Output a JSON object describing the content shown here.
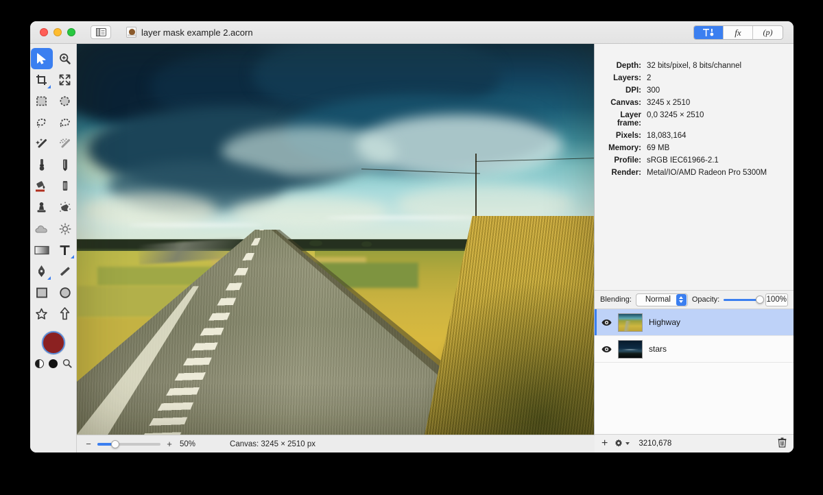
{
  "window": {
    "document_name": "layer mask example 2.acorn",
    "traffic_lights": [
      "close",
      "minimize",
      "zoom"
    ],
    "sidebar_toggle": "sidebar-toggle",
    "view_segments": [
      {
        "name": "inspector",
        "label": "",
        "selected": true
      },
      {
        "name": "filters",
        "label": "fx",
        "selected": false
      },
      {
        "name": "presets",
        "label": "(p)",
        "selected": false
      }
    ]
  },
  "toolbox": {
    "tools": [
      {
        "name": "move-tool",
        "icon": "cursor-arrow-icon",
        "active": true
      },
      {
        "name": "zoom-tool",
        "icon": "magnifier-plus-icon",
        "active": false
      },
      {
        "name": "crop-tool",
        "icon": "crop-icon",
        "active": false,
        "submenu": true
      },
      {
        "name": "transform-tool",
        "icon": "arrows-expand-icon",
        "active": false
      },
      {
        "name": "rectangular-select-tool",
        "icon": "marquee-rect-icon",
        "active": false
      },
      {
        "name": "elliptical-select-tool",
        "icon": "marquee-ellipse-icon",
        "active": false
      },
      {
        "name": "lasso-tool",
        "icon": "lasso-icon",
        "active": false
      },
      {
        "name": "polygon-lasso-tool",
        "icon": "polygon-lasso-icon",
        "active": false
      },
      {
        "name": "magic-wand-tool",
        "icon": "magic-wand-icon",
        "active": false
      },
      {
        "name": "instant-alpha-tool",
        "icon": "instant-alpha-icon",
        "active": false
      },
      {
        "name": "brush-tool",
        "icon": "brush-icon",
        "active": false
      },
      {
        "name": "pencil-tool",
        "icon": "pencil-icon",
        "active": false
      },
      {
        "name": "paint-bucket-tool",
        "icon": "paint-bucket-icon",
        "active": false
      },
      {
        "name": "eraser-tool",
        "icon": "eraser-icon",
        "active": false
      },
      {
        "name": "clone-stamp-tool",
        "icon": "clone-stamp-icon",
        "active": false
      },
      {
        "name": "smudge-tool",
        "icon": "smudge-icon",
        "active": false
      },
      {
        "name": "blur-tool",
        "icon": "cloud-icon",
        "active": false
      },
      {
        "name": "dodge-tool",
        "icon": "sun-icon",
        "active": false
      },
      {
        "name": "gradient-tool",
        "icon": "gradient-icon",
        "active": false
      },
      {
        "name": "text-tool",
        "icon": "text-t-icon",
        "active": false,
        "submenu": true
      },
      {
        "name": "pen-tool",
        "icon": "fountain-pen-icon",
        "active": false,
        "submenu": true
      },
      {
        "name": "line-tool",
        "icon": "line-icon",
        "active": false
      },
      {
        "name": "rectangle-shape-tool",
        "icon": "square-icon",
        "active": false
      },
      {
        "name": "ellipse-shape-tool",
        "icon": "circle-icon",
        "active": false
      },
      {
        "name": "star-shape-tool",
        "icon": "star-icon",
        "active": false
      },
      {
        "name": "arrow-shape-tool",
        "icon": "arrow-up-icon",
        "active": false
      }
    ],
    "foreground_color": "#8b2121",
    "swatch_ring_color": "#5a8cd8",
    "color_extras": [
      {
        "name": "color-mode-toggle",
        "icon": "half-circle-icon"
      },
      {
        "name": "black-swatch",
        "icon": "filled-circle-icon"
      },
      {
        "name": "color-picker",
        "icon": "magnifier-icon"
      }
    ]
  },
  "info_panel": {
    "rows": [
      {
        "key": "Depth:",
        "value": "32 bits/pixel, 8 bits/channel"
      },
      {
        "key": "Layers:",
        "value": "2"
      },
      {
        "key": "DPI:",
        "value": "300"
      },
      {
        "key": "Canvas:",
        "value": "3245 x 2510"
      },
      {
        "key": "Layer frame:",
        "value": "0,0 3245 × 2510"
      },
      {
        "key": "Pixels:",
        "value": "18,083,164"
      },
      {
        "key": "Memory:",
        "value": "69 MB"
      },
      {
        "key": "Profile:",
        "value": "sRGB IEC61966-2.1"
      },
      {
        "key": "Render:",
        "value": "Metal/IO/AMD Radeon Pro 5300M"
      }
    ]
  },
  "blending_bar": {
    "blending_label": "Blending:",
    "blending_value": "Normal",
    "opacity_label": "Opacity:",
    "opacity_value": "100%",
    "opacity_percent": 100
  },
  "layers": [
    {
      "name": "Highway",
      "selected": true,
      "visible": true,
      "thumb": "highway-thumbnail"
    },
    {
      "name": "stars",
      "selected": false,
      "visible": true,
      "thumb": "stars-thumbnail"
    }
  ],
  "layer_tools": {
    "add_label": "+",
    "gear": "gear-icon",
    "coordinates": "3210,678",
    "delete": "trash-icon"
  },
  "status_bar": {
    "zoom_minus": "−",
    "zoom_plus": "+",
    "zoom_level": "50%",
    "zoom_percent": 50,
    "canvas_info": "Canvas: 3245 × 2510 px"
  },
  "canvas_image": {
    "description": "Empty rural highway receding toward the horizon, golden dry grass fields on both sides, dramatic teal sky with dark storm clouds",
    "accent_blue": "#3b7ff0",
    "selected_layer_bg": "#bed2f8"
  }
}
